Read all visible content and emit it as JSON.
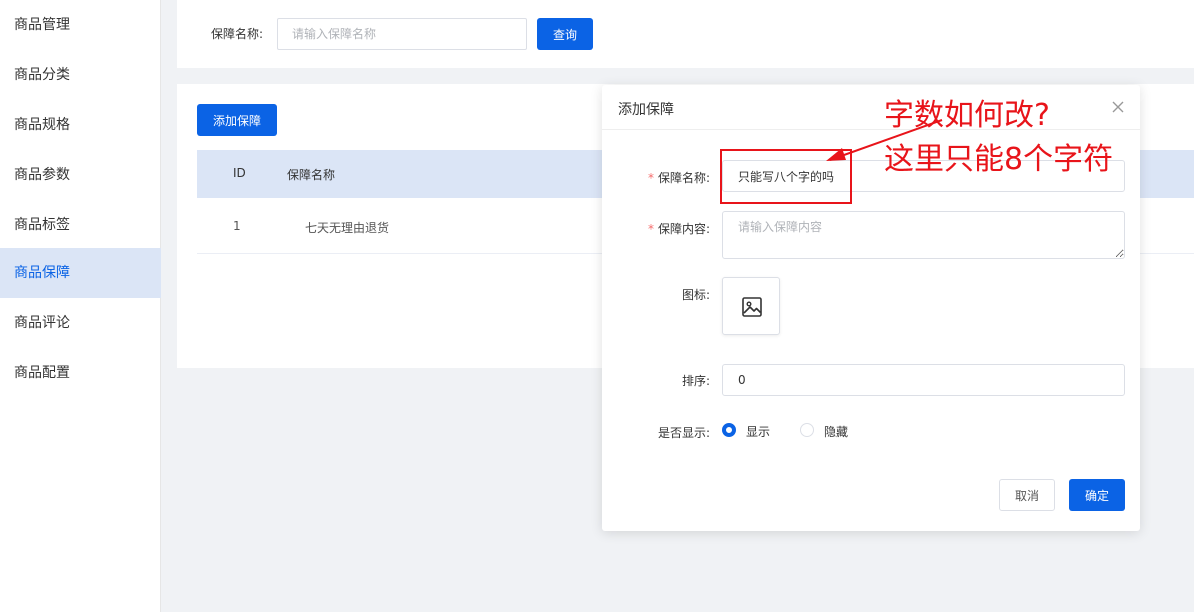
{
  "sidebar": {
    "items": [
      {
        "label": "商品管理"
      },
      {
        "label": "商品分类"
      },
      {
        "label": "商品规格"
      },
      {
        "label": "商品参数"
      },
      {
        "label": "商品标签"
      },
      {
        "label": "商品保障",
        "active": true
      },
      {
        "label": "商品评论"
      },
      {
        "label": "商品配置"
      }
    ]
  },
  "search": {
    "label": "保障名称:",
    "placeholder": "请输入保障名称",
    "button": "查询"
  },
  "main": {
    "add_button": "添加保障",
    "table": {
      "headers": [
        "ID",
        "保障名称"
      ],
      "rows": [
        {
          "id": "1",
          "name": "七天无理由退货"
        }
      ]
    }
  },
  "dialog": {
    "title": "添加保障",
    "close_icon": "close-icon",
    "fields": {
      "name": {
        "label": "保障名称:",
        "value": "只能写八个字的吗",
        "required": true
      },
      "content": {
        "label": "保障内容:",
        "placeholder": "请输入保障内容",
        "required": true
      },
      "icon": {
        "label": "图标:",
        "upload_icon": "image-icon"
      },
      "sort": {
        "label": "排序:",
        "value": "0"
      },
      "display": {
        "label": "是否显示:",
        "options": [
          "显示",
          "隐藏"
        ],
        "selected": "显示"
      }
    },
    "cancel": "取消",
    "confirm": "确定"
  },
  "annotation": {
    "line1": "字数如何改?",
    "line2": "这里只能8个字符",
    "color": "#e8141a"
  },
  "colors": {
    "primary": "#0b63e5",
    "sidebar_active_bg": "#dbe5f6",
    "required": "#f56c6c"
  }
}
